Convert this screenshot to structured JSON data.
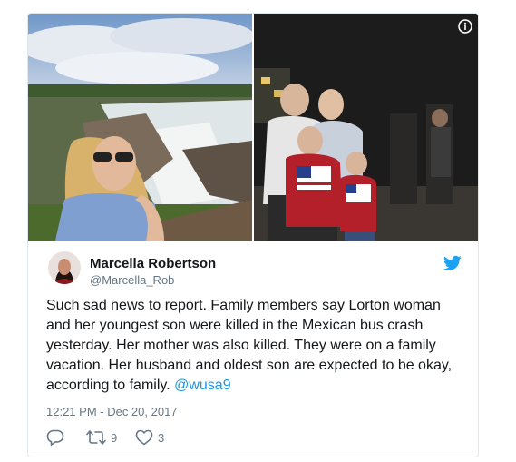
{
  "tweet": {
    "author_name": "Marcella Robertson",
    "author_handle": "@Marcella_Rob",
    "text_prefix": "Such sad news to report. Family members say Lorton woman and her youngest son were killed in the Mexican bus crash yesterday. Her mother was also killed. They were on a family vacation. Her husband and oldest son are expected to be okay, according to family.",
    "mention": "@wusa9",
    "timestamp": "12:21 PM - Dec 20, 2017",
    "retweet_count": "9",
    "like_count": "3"
  },
  "icons": {
    "info": "info-icon",
    "twitter_bird": "twitter-bird-icon",
    "reply": "reply-icon",
    "retweet": "retweet-icon",
    "like": "heart-icon"
  },
  "colors": {
    "link": "#1b95e0",
    "twitter_blue": "#1da1f2",
    "muted_text": "#657786",
    "text": "#14171a",
    "border": "#e1e8ed"
  }
}
